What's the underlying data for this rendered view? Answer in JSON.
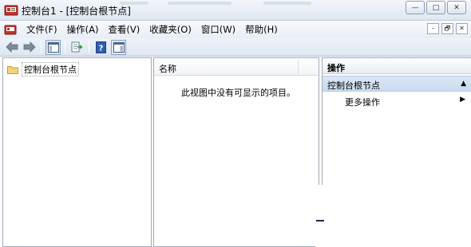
{
  "window": {
    "title": "控制台1 - [控制台根节点]",
    "buttons": {
      "minimize": "—",
      "maximize": "□",
      "close": "✕"
    }
  },
  "menu": {
    "items": [
      "文件(F)",
      "操作(A)",
      "查看(V)",
      "收藏夹(O)",
      "窗口(W)",
      "帮助(H)"
    ],
    "mdi_buttons": {
      "minimize": "–",
      "restore": "🗗",
      "close": "✕"
    }
  },
  "tree": {
    "root_label": "控制台根节点"
  },
  "list": {
    "column_name": "名称",
    "empty_message": "此视图中没有可显示的项目。"
  },
  "actions": {
    "header": "操作",
    "section_label": "控制台根节点",
    "more_actions": "更多操作",
    "section_arrow": "▲",
    "more_arrow": "▶"
  }
}
